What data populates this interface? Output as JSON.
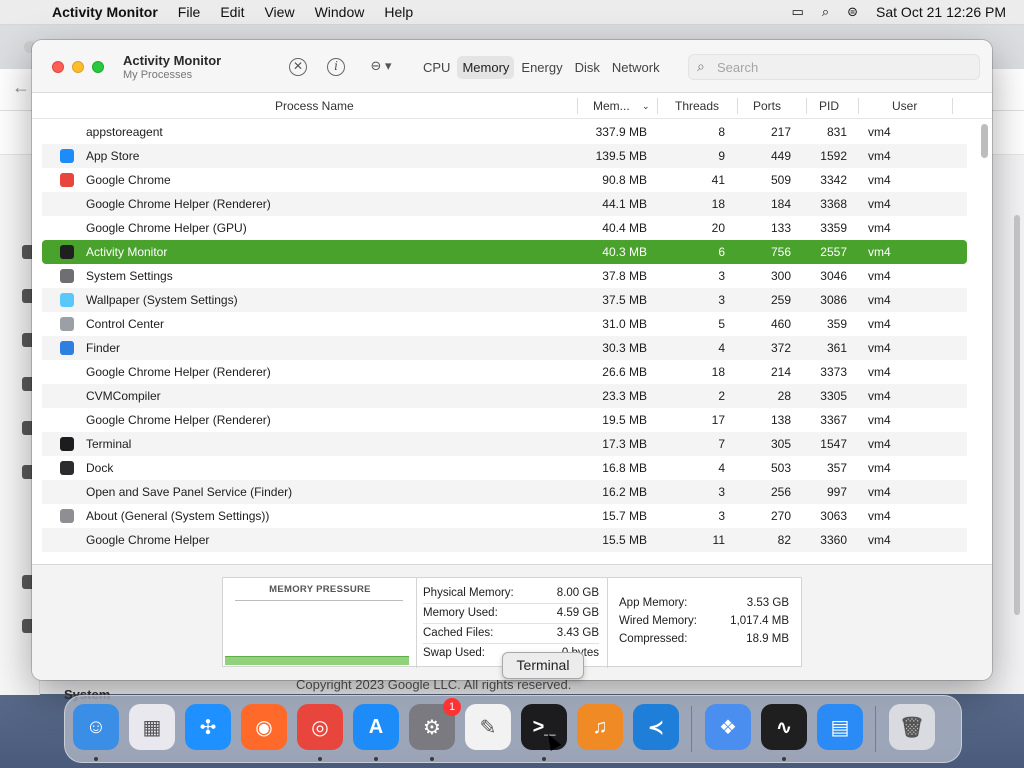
{
  "menubar": {
    "app_name": "Activity Monitor",
    "menus": [
      "File",
      "Edit",
      "View",
      "Window",
      "Help"
    ],
    "clock": "Sat Oct 21  12:26 PM"
  },
  "background": {
    "footer_text": "Copyright 2023 Google LLC. All rights reserved.",
    "system_label": "System"
  },
  "window": {
    "title": "Activity Monitor",
    "subtitle": "My Processes",
    "tabs": [
      {
        "label": "CPU"
      },
      {
        "label": "Memory"
      },
      {
        "label": "Energy"
      },
      {
        "label": "Disk"
      },
      {
        "label": "Network"
      }
    ],
    "search_placeholder": "Search",
    "columns": {
      "name": "Process Name",
      "mem": "Mem...",
      "threads": "Threads",
      "ports": "Ports",
      "pid": "PID",
      "user": "User"
    },
    "rows": [
      {
        "name": "appstoreagent",
        "mem": "337.9 MB",
        "threads": "8",
        "ports": "217",
        "pid": "831",
        "user": "vm4",
        "icon": "none",
        "color": ""
      },
      {
        "name": "App Store",
        "mem": "139.5 MB",
        "threads": "9",
        "ports": "449",
        "pid": "1592",
        "user": "vm4",
        "icon": "app-store-icon",
        "color": "#1d8cf8"
      },
      {
        "name": "Google Chrome",
        "mem": "90.8 MB",
        "threads": "41",
        "ports": "509",
        "pid": "3342",
        "user": "vm4",
        "icon": "chrome-icon",
        "color": "#e8453c"
      },
      {
        "name": "Google Chrome Helper (Renderer)",
        "mem": "44.1 MB",
        "threads": "18",
        "ports": "184",
        "pid": "3368",
        "user": "vm4",
        "icon": "none",
        "color": ""
      },
      {
        "name": "Google Chrome Helper (GPU)",
        "mem": "40.4 MB",
        "threads": "20",
        "ports": "133",
        "pid": "3359",
        "user": "vm4",
        "icon": "none",
        "color": ""
      },
      {
        "name": "Activity Monitor",
        "mem": "40.3 MB",
        "threads": "6",
        "ports": "756",
        "pid": "2557",
        "user": "vm4",
        "icon": "activity-monitor-icon",
        "color": "#1f1f1f"
      },
      {
        "name": "System Settings",
        "mem": "37.8 MB",
        "threads": "3",
        "ports": "300",
        "pid": "3046",
        "user": "vm4",
        "icon": "gear-icon",
        "color": "#6e6e73"
      },
      {
        "name": "Wallpaper (System Settings)",
        "mem": "37.5 MB",
        "threads": "3",
        "ports": "259",
        "pid": "3086",
        "user": "vm4",
        "icon": "wallpaper-icon",
        "color": "#5ac8fa"
      },
      {
        "name": "Control Center",
        "mem": "31.0 MB",
        "threads": "5",
        "ports": "460",
        "pid": "359",
        "user": "vm4",
        "icon": "control-center-icon",
        "color": "#9aa0a6"
      },
      {
        "name": "Finder",
        "mem": "30.3 MB",
        "threads": "4",
        "ports": "372",
        "pid": "361",
        "user": "vm4",
        "icon": "finder-icon",
        "color": "#2f7fe0"
      },
      {
        "name": "Google Chrome Helper (Renderer)",
        "mem": "26.6 MB",
        "threads": "18",
        "ports": "214",
        "pid": "3373",
        "user": "vm4",
        "icon": "none",
        "color": ""
      },
      {
        "name": "CVMCompiler",
        "mem": "23.3 MB",
        "threads": "2",
        "ports": "28",
        "pid": "3305",
        "user": "vm4",
        "icon": "none",
        "color": ""
      },
      {
        "name": "Google Chrome Helper (Renderer)",
        "mem": "19.5 MB",
        "threads": "17",
        "ports": "138",
        "pid": "3367",
        "user": "vm4",
        "icon": "none",
        "color": ""
      },
      {
        "name": "Terminal",
        "mem": "17.3 MB",
        "threads": "7",
        "ports": "305",
        "pid": "1547",
        "user": "vm4",
        "icon": "terminal-icon",
        "color": "#1c1c1e"
      },
      {
        "name": "Dock",
        "mem": "16.8 MB",
        "threads": "4",
        "ports": "503",
        "pid": "357",
        "user": "vm4",
        "icon": "dock-icon",
        "color": "#2c2c2e"
      },
      {
        "name": "Open and Save Panel Service (Finder)",
        "mem": "16.2 MB",
        "threads": "3",
        "ports": "256",
        "pid": "997",
        "user": "vm4",
        "icon": "none",
        "color": ""
      },
      {
        "name": "About (General (System Settings))",
        "mem": "15.7 MB",
        "threads": "3",
        "ports": "270",
        "pid": "3063",
        "user": "vm4",
        "icon": "about-icon",
        "color": "#8e8e93"
      },
      {
        "name": "Google Chrome Helper",
        "mem": "15.5 MB",
        "threads": "11",
        "ports": "82",
        "pid": "3360",
        "user": "vm4",
        "icon": "none",
        "color": ""
      }
    ],
    "selected_row": 5,
    "selection_color": "#48a22c"
  },
  "memory_panel": {
    "pressure_label": "MEMORY PRESSURE",
    "pressure_fraction": 0.97,
    "stats": [
      {
        "k": "Physical Memory:",
        "v": "8.00 GB"
      },
      {
        "k": "Memory Used:",
        "v": "4.59 GB"
      },
      {
        "k": "Cached Files:",
        "v": "3.43 GB"
      },
      {
        "k": "Swap Used:",
        "v": "0 bytes"
      }
    ],
    "stats2": [
      {
        "k": "App Memory:",
        "v": "3.53 GB"
      },
      {
        "k": "Wired Memory:",
        "v": "1,017.4 MB"
      },
      {
        "k": "Compressed:",
        "v": "18.9 MB"
      }
    ]
  },
  "tooltip": "Terminal",
  "dock": {
    "apps": [
      {
        "name": "finder-icon",
        "color": "#3a8ee6",
        "glyph": "☺",
        "running": true
      },
      {
        "name": "launchpad-icon",
        "color": "#e8e8ee",
        "glyph": "▦",
        "running": false
      },
      {
        "name": "safari-icon",
        "color": "#1e90ff",
        "glyph": "✣",
        "running": false
      },
      {
        "name": "firefox-icon",
        "color": "#ff6a2b",
        "glyph": "◉",
        "running": false
      },
      {
        "name": "chrome-icon",
        "color": "#e8453c",
        "glyph": "◎",
        "running": true
      },
      {
        "name": "app-store-icon",
        "color": "#1d8cf8",
        "glyph": "A",
        "running": true
      },
      {
        "name": "system-settings-icon",
        "color": "#7a7a80",
        "glyph": "⚙",
        "running": true,
        "badge": "1"
      },
      {
        "name": "textedit-icon",
        "color": "#f2f2f2",
        "glyph": "✎",
        "running": false
      },
      {
        "name": "terminal-icon",
        "color": "#1c1c1e",
        "glyph": ">_",
        "running": true
      },
      {
        "name": "garageband-icon",
        "color": "#f08a24",
        "glyph": "♫",
        "running": false
      },
      {
        "name": "vscode-icon",
        "color": "#1f7fd8",
        "glyph": "≺",
        "running": false
      },
      {
        "name": "control-center-icon",
        "color": "#4a8ef0",
        "glyph": "❖",
        "running": false
      },
      {
        "name": "activity-monitor-icon",
        "color": "#1f1f1f",
        "glyph": "∿",
        "running": true
      },
      {
        "name": "keynote-icon",
        "color": "#2a8af6",
        "glyph": "▤",
        "running": false
      },
      {
        "name": "trash-icon",
        "color": "#d9dbe0",
        "glyph": "🗑",
        "running": false
      }
    ]
  }
}
